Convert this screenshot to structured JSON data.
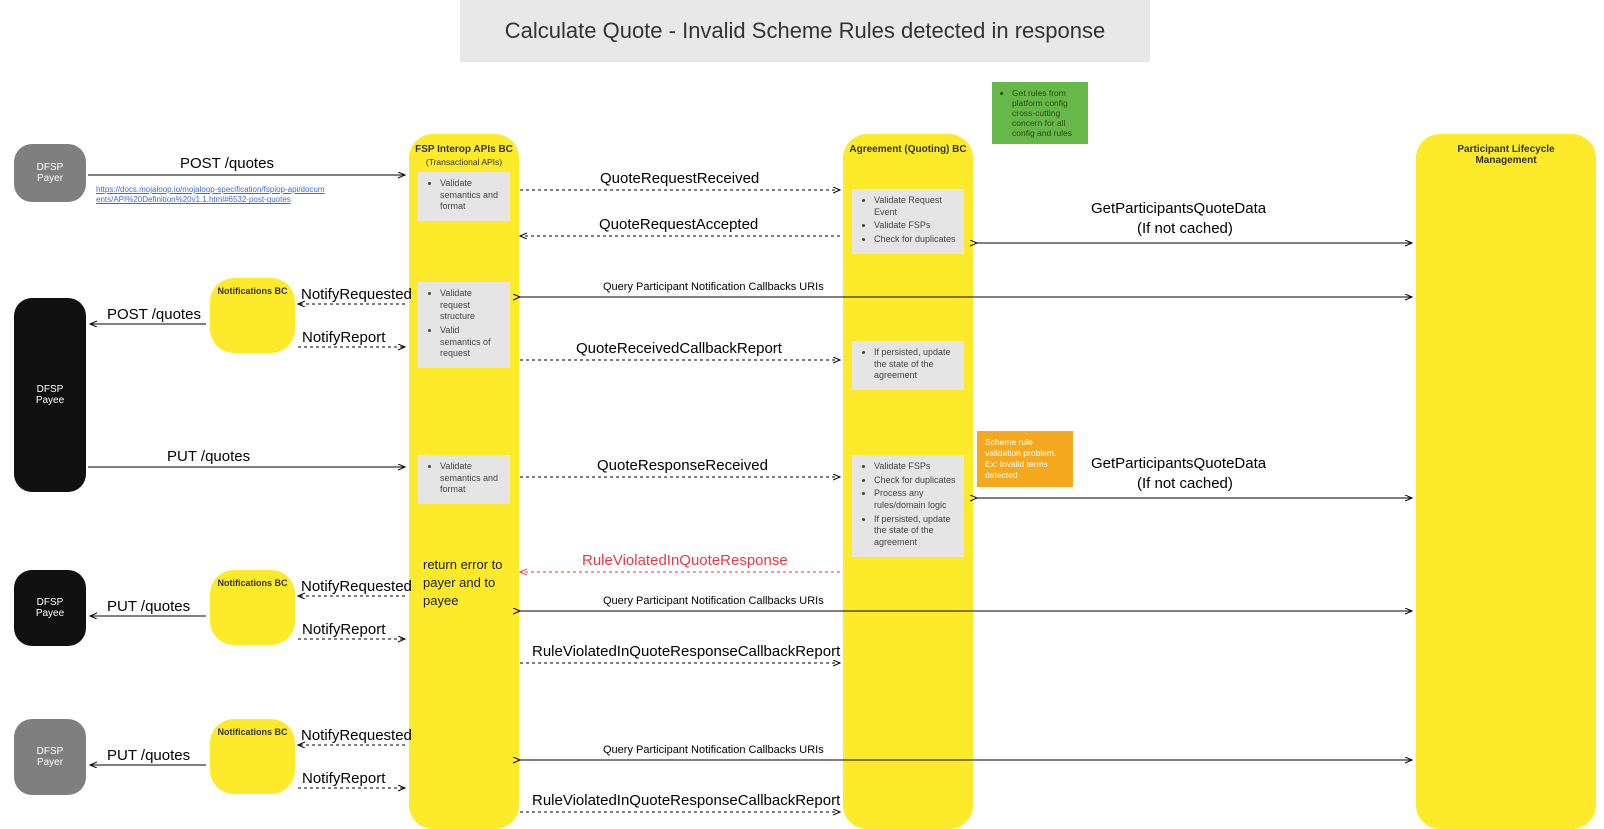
{
  "title": "Calculate Quote - Invalid Scheme Rules detected in response",
  "actors": {
    "payer_top": {
      "line1": "DFSP",
      "line2": "Payer"
    },
    "payee_mid": {
      "line1": "DFSP",
      "line2": "Payee"
    },
    "payee_low": {
      "line1": "DFSP",
      "line2": "Payee"
    },
    "payer_bot": {
      "line1": "DFSP",
      "line2": "Payer"
    }
  },
  "lifelines": {
    "fsp": {
      "title": "FSP Interop APIs BC",
      "sub": "(Transactional APIs)"
    },
    "agreement": {
      "title": "Agreement (Quoting) BC"
    },
    "participant": {
      "title": "Participant Lifecycle Management"
    }
  },
  "notifications_label": "Notifications BC",
  "green_note": "Get rules from platform config cross-cutting concern for all config and rules",
  "orange_note": "Scheme rule validation problem. Ex: Invalid terms detected",
  "fsp_notes": {
    "n1": [
      "Validate semantics and format"
    ],
    "n2": [
      "Validate request structure",
      "Valid semantics of request"
    ],
    "n3": [
      "Validate semantics and format"
    ]
  },
  "agreement_notes": {
    "a1": [
      "Validate Request Event",
      "Validate FSPs",
      "Check for duplicates"
    ],
    "a2": [
      "If persisted, update the state of the agreement"
    ],
    "a3": [
      "Validate FSPs",
      "Check for duplicates",
      "Process any rules/domain logic",
      "If persisted, update the state of the agreement"
    ]
  },
  "return_note": "return error to payer and to payee",
  "link_text": "https://docs.mojaloop.io/mojaloop-specification/fspiop-api/documents/API%20Definition%20v1.1.html#6532-post-quotes",
  "messages": {
    "post_quotes": "POST /quotes",
    "put_quotes": "PUT /quotes",
    "notify_requested": "NotifyRequested",
    "notify_report": "NotifyReport",
    "quote_request_received": "QuoteRequestReceived",
    "quote_request_accepted": "QuoteRequestAccepted",
    "get_participants": "GetParticipantsQuoteData",
    "if_not_cached": "(If not cached)",
    "query_callbacks": "Query Participant Notification Callbacks URIs",
    "quote_received_cb": "QuoteReceivedCallbackReport",
    "quote_response_received": "QuoteResponseReceived",
    "rule_violated": "RuleViolatedInQuoteResponse",
    "rule_violated_cb": "RuleViolatedInQuoteResponseCallbackReport"
  }
}
